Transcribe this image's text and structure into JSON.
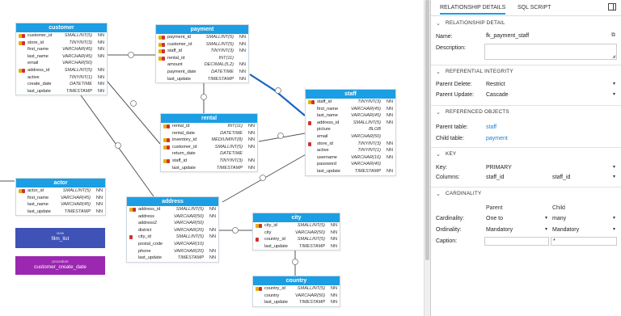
{
  "tables": {
    "customer": {
      "title": "customer",
      "rows": [
        {
          "name": "customer_id",
          "type": "SMALLINT(5)",
          "nn": "NN",
          "key": "pk"
        },
        {
          "name": "store_id",
          "type": "TINYINT(3)",
          "nn": "NN",
          "key": "fk"
        },
        {
          "name": "first_name",
          "type": "VARCHAR(45)",
          "nn": "NN",
          "key": ""
        },
        {
          "name": "last_name",
          "type": "VARCHAR(45)",
          "nn": "NN",
          "key": ""
        },
        {
          "name": "email",
          "type": "VARCHAR(50)",
          "nn": "",
          "key": ""
        },
        {
          "name": "address_id",
          "type": "SMALLINT(5)",
          "nn": "NN",
          "key": "fk"
        },
        {
          "name": "active",
          "type": "TINYINT(1)",
          "nn": "NN",
          "key": ""
        },
        {
          "name": "create_date",
          "type": "DATETIME",
          "nn": "NN",
          "key": ""
        },
        {
          "name": "last_update",
          "type": "TIMESTAMP",
          "nn": "NN",
          "key": ""
        }
      ]
    },
    "payment": {
      "title": "payment",
      "rows": [
        {
          "name": "payment_id",
          "type": "SMALLINT(5)",
          "nn": "NN",
          "key": "pk"
        },
        {
          "name": "customer_id",
          "type": "SMALLINT(5)",
          "nn": "NN",
          "key": "fk"
        },
        {
          "name": "staff_id",
          "type": "TINYINT(3)",
          "nn": "NN",
          "key": "fk"
        },
        {
          "name": "rental_id",
          "type": "INT(11)",
          "nn": "",
          "key": "fk"
        },
        {
          "name": "amount",
          "type": "DECIMAL(5,2)",
          "nn": "NN",
          "key": ""
        },
        {
          "name": "payment_date",
          "type": "DATETIME",
          "nn": "NN",
          "key": ""
        },
        {
          "name": "last_update",
          "type": "TIMESTAMP",
          "nn": "NN",
          "key": ""
        }
      ]
    },
    "rental": {
      "title": "rental",
      "rows": [
        {
          "name": "rental_id",
          "type": "INT(11)",
          "nn": "NN",
          "key": "pk"
        },
        {
          "name": "rental_date",
          "type": "DATETIME",
          "nn": "NN",
          "key": ""
        },
        {
          "name": "inventory_id",
          "type": "MEDIUMINT(8)",
          "nn": "NN",
          "key": "fk"
        },
        {
          "name": "customer_id",
          "type": "SMALLINT(5)",
          "nn": "NN",
          "key": "fk"
        },
        {
          "name": "return_date",
          "type": "DATETIME",
          "nn": "",
          "key": ""
        },
        {
          "name": "staff_id",
          "type": "TINYINT(3)",
          "nn": "NN",
          "key": "fk"
        },
        {
          "name": "last_update",
          "type": "TIMESTAMP",
          "nn": "NN",
          "key": ""
        }
      ]
    },
    "staff": {
      "title": "staff",
      "rows": [
        {
          "name": "staff_id",
          "type": "TINYINT(3)",
          "nn": "NN",
          "key": "pk"
        },
        {
          "name": "first_name",
          "type": "VARCHAR(45)",
          "nn": "NN",
          "key": ""
        },
        {
          "name": "last_name",
          "type": "VARCHAR(45)",
          "nn": "NN",
          "key": ""
        },
        {
          "name": "address_id",
          "type": "SMALLINT(5)",
          "nn": "NN",
          "key": "fko"
        },
        {
          "name": "picture",
          "type": "BLOB",
          "nn": "",
          "key": ""
        },
        {
          "name": "email",
          "type": "VARCHAR(50)",
          "nn": "",
          "key": ""
        },
        {
          "name": "store_id",
          "type": "TINYINT(3)",
          "nn": "NN",
          "key": "fko"
        },
        {
          "name": "active",
          "type": "TINYINT(1)",
          "nn": "NN",
          "key": ""
        },
        {
          "name": "username",
          "type": "VARCHAR(16)",
          "nn": "NN",
          "key": ""
        },
        {
          "name": "password",
          "type": "VARCHAR(40)",
          "nn": "",
          "key": ""
        },
        {
          "name": "last_update",
          "type": "TIMESTAMP",
          "nn": "NN",
          "key": ""
        }
      ]
    },
    "actor": {
      "title": "actor",
      "rows": [
        {
          "name": "actor_id",
          "type": "SMALLINT(5)",
          "nn": "NN",
          "key": "pk"
        },
        {
          "name": "first_name",
          "type": "VARCHAR(45)",
          "nn": "NN",
          "key": ""
        },
        {
          "name": "last_name",
          "type": "VARCHAR(45)",
          "nn": "NN",
          "key": ""
        },
        {
          "name": "last_update",
          "type": "TIMESTAMP",
          "nn": "NN",
          "key": ""
        }
      ]
    },
    "address": {
      "title": "address",
      "rows": [
        {
          "name": "address_id",
          "type": "SMALLINT(5)",
          "nn": "NN",
          "key": "pk"
        },
        {
          "name": "address",
          "type": "VARCHAR(50)",
          "nn": "NN",
          "key": ""
        },
        {
          "name": "address2",
          "type": "VARCHAR(50)",
          "nn": "",
          "key": ""
        },
        {
          "name": "district",
          "type": "VARCHAR(20)",
          "nn": "NN",
          "key": ""
        },
        {
          "name": "city_id",
          "type": "SMALLINT(5)",
          "nn": "NN",
          "key": "fko"
        },
        {
          "name": "postal_code",
          "type": "VARCHAR(10)",
          "nn": "",
          "key": ""
        },
        {
          "name": "phone",
          "type": "VARCHAR(20)",
          "nn": "NN",
          "key": ""
        },
        {
          "name": "last_update",
          "type": "TIMESTAMP",
          "nn": "NN",
          "key": ""
        }
      ]
    },
    "city": {
      "title": "city",
      "rows": [
        {
          "name": "city_id",
          "type": "SMALLINT(5)",
          "nn": "NN",
          "key": "pk"
        },
        {
          "name": "city",
          "type": "VARCHAR(50)",
          "nn": "NN",
          "key": ""
        },
        {
          "name": "country_id",
          "type": "SMALLINT(5)",
          "nn": "NN",
          "key": "fko"
        },
        {
          "name": "last_update",
          "type": "TIMESTAMP",
          "nn": "NN",
          "key": ""
        }
      ]
    },
    "country": {
      "title": "country",
      "rows": [
        {
          "name": "country_id",
          "type": "SMALLINT(5)",
          "nn": "NN",
          "key": "pk"
        },
        {
          "name": "country",
          "type": "VARCHAR(50)",
          "nn": "NN",
          "key": ""
        },
        {
          "name": "last_update",
          "type": "TIMESTAMP",
          "nn": "NN",
          "key": ""
        }
      ]
    }
  },
  "notes": {
    "view": {
      "kind": "view",
      "name": "film_list",
      "color": "#3f52b5"
    },
    "procedure": {
      "kind": "procedure",
      "name": "customer_create_date",
      "color": "#9c27b0"
    }
  },
  "panel": {
    "tabs": [
      "RELATIONSHIP DETAILS",
      "SQL SCRIPT"
    ],
    "sections": {
      "detail": "RELATIONSHIP DETAIL",
      "integrity": "REFERENTIAL INTEGRITY",
      "refobj": "REFERENCED OBJECTS",
      "key": "KEY",
      "cardinality": "CARDINALITY"
    },
    "name_label": "Name:",
    "name_value": "fk_payment_staff",
    "description_label": "Description:",
    "parent_delete_label": "Parent Delete:",
    "parent_delete_value": "Restrict",
    "parent_update_label": "Parent Update:",
    "parent_update_value": "Cascade",
    "parent_table_label": "Parent table:",
    "parent_table_value": "staff",
    "child_table_label": "Child table:",
    "child_table_value": "payment",
    "key_label": "Key:",
    "key_value": "PRIMARY",
    "columns_label": "Columns:",
    "columns_parent": "staff_id",
    "columns_child": "staff_id",
    "col_parent": "Parent",
    "col_child": "Child",
    "cardinality_label": "Cardinality:",
    "cardinality_parent": "One to",
    "cardinality_child": "many",
    "ordinality_label": "Ordinality:",
    "ordinality_parent": "Mandatory",
    "ordinality_child": "Mandatory",
    "caption_label": "Caption:",
    "caption_child": "*"
  },
  "colors": {
    "header": "#1b9ee3",
    "selected_relation": "#1565c0",
    "pk": "#e3b000",
    "fk": "#d0322d"
  }
}
